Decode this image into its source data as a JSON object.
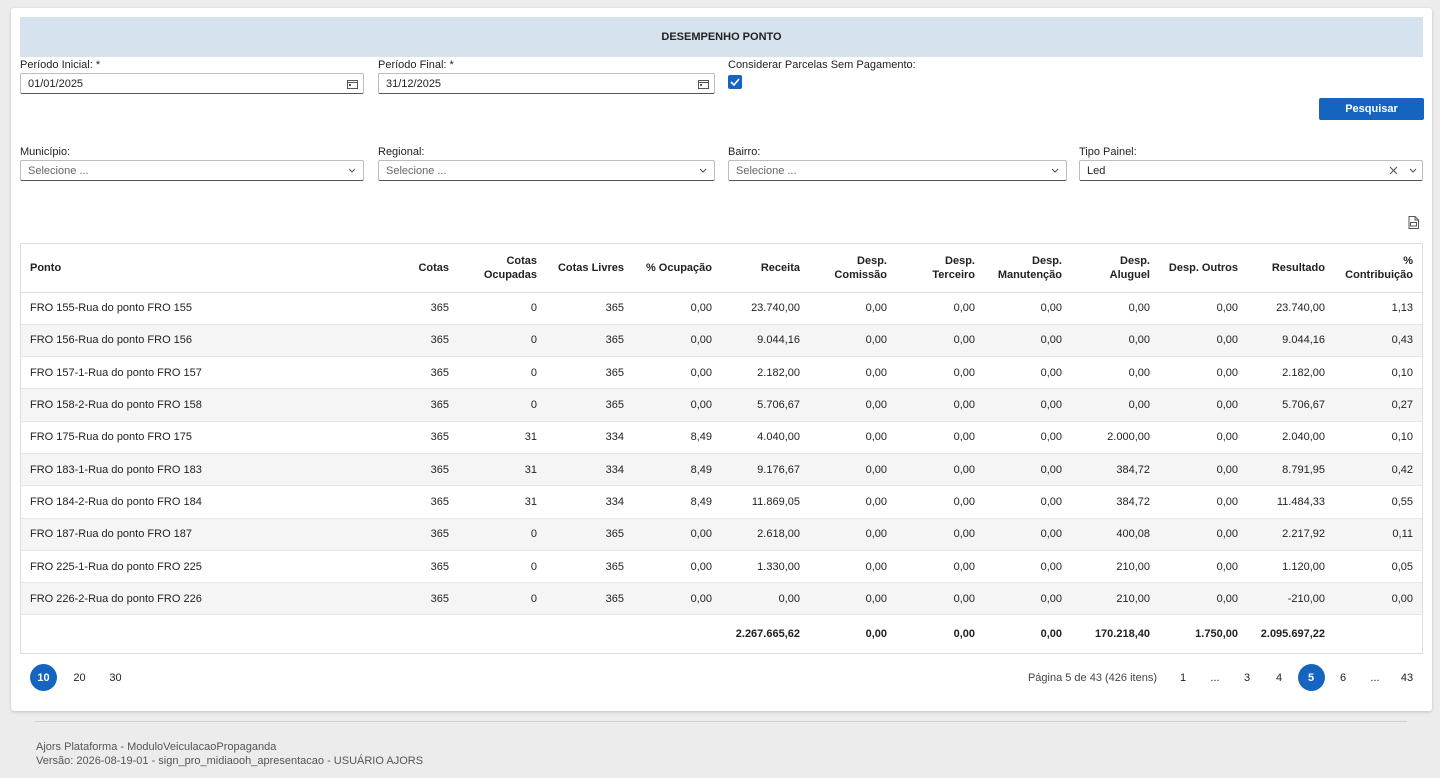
{
  "title": "DESEMPENHO PONTO",
  "filters": {
    "periodo_inicial": {
      "label": "Período Inicial: *",
      "value": "01/01/2025"
    },
    "periodo_final": {
      "label": "Período Final: *",
      "value": "31/12/2025"
    },
    "considerar": {
      "label": "Considerar Parcelas Sem Pagamento:",
      "checked": true
    },
    "search_label": "Pesquisar",
    "municipio": {
      "label": "Município:",
      "placeholder": "Selecione ..."
    },
    "regional": {
      "label": "Regional:",
      "placeholder": "Selecione ..."
    },
    "bairro": {
      "label": "Bairro:",
      "placeholder": "Selecione ..."
    },
    "tipo_painel": {
      "label": "Tipo Painel:",
      "value": "Led"
    }
  },
  "table": {
    "headers": [
      "Ponto",
      "Cotas",
      "Cotas Ocupadas",
      "Cotas Livres",
      "% Ocupação",
      "Receita",
      "Desp. Comissão",
      "Desp. Terceiro",
      "Desp. Manutenção",
      "Desp. Aluguel",
      "Desp. Outros",
      "Resultado",
      "% Contribuição"
    ],
    "rows": [
      [
        "FRO 155-Rua do ponto FRO 155",
        "365",
        "0",
        "365",
        "0,00",
        "23.740,00",
        "0,00",
        "0,00",
        "0,00",
        "0,00",
        "0,00",
        "23.740,00",
        "1,13"
      ],
      [
        "FRO 156-Rua do ponto FRO 156",
        "365",
        "0",
        "365",
        "0,00",
        "9.044,16",
        "0,00",
        "0,00",
        "0,00",
        "0,00",
        "0,00",
        "9.044,16",
        "0,43"
      ],
      [
        "FRO 157-1-Rua do ponto FRO 157",
        "365",
        "0",
        "365",
        "0,00",
        "2.182,00",
        "0,00",
        "0,00",
        "0,00",
        "0,00",
        "0,00",
        "2.182,00",
        "0,10"
      ],
      [
        "FRO 158-2-Rua do ponto FRO 158",
        "365",
        "0",
        "365",
        "0,00",
        "5.706,67",
        "0,00",
        "0,00",
        "0,00",
        "0,00",
        "0,00",
        "5.706,67",
        "0,27"
      ],
      [
        "FRO 175-Rua do ponto FRO 175",
        "365",
        "31",
        "334",
        "8,49",
        "4.040,00",
        "0,00",
        "0,00",
        "0,00",
        "2.000,00",
        "0,00",
        "2.040,00",
        "0,10"
      ],
      [
        "FRO 183-1-Rua do ponto FRO 183",
        "365",
        "31",
        "334",
        "8,49",
        "9.176,67",
        "0,00",
        "0,00",
        "0,00",
        "384,72",
        "0,00",
        "8.791,95",
        "0,42"
      ],
      [
        "FRO 184-2-Rua do ponto FRO 184",
        "365",
        "31",
        "334",
        "8,49",
        "11.869,05",
        "0,00",
        "0,00",
        "0,00",
        "384,72",
        "0,00",
        "11.484,33",
        "0,55"
      ],
      [
        "FRO 187-Rua do ponto FRO 187",
        "365",
        "0",
        "365",
        "0,00",
        "2.618,00",
        "0,00",
        "0,00",
        "0,00",
        "400,08",
        "0,00",
        "2.217,92",
        "0,11"
      ],
      [
        "FRO 225-1-Rua do ponto FRO 225",
        "365",
        "0",
        "365",
        "0,00",
        "1.330,00",
        "0,00",
        "0,00",
        "0,00",
        "210,00",
        "0,00",
        "1.120,00",
        "0,05"
      ],
      [
        "FRO 226-2-Rua do ponto FRO 226",
        "365",
        "0",
        "365",
        "0,00",
        "0,00",
        "0,00",
        "0,00",
        "0,00",
        "210,00",
        "0,00",
        "-210,00",
        "0,00"
      ]
    ],
    "totals": [
      "",
      "",
      "",
      "",
      "",
      "2.267.665,62",
      "0,00",
      "0,00",
      "0,00",
      "170.218,40",
      "1.750,00",
      "2.095.697,22",
      ""
    ]
  },
  "pager": {
    "sizes": [
      "10",
      "20",
      "30"
    ],
    "active_size": "10",
    "info": "Página 5 de 43 (426 itens)",
    "pages": [
      "1",
      "...",
      "3",
      "4",
      "5",
      "6",
      "...",
      "43"
    ],
    "active_page": "5"
  },
  "footer": {
    "line1": "Ajors Plataforma - ModuloVeiculacaoPropaganda",
    "line2": "Versão: 2026-08-19-01 - sign_pro_midiaooh_apresentacao - USUÁRIO AJORS"
  },
  "colors": {
    "accent": "#1565c0",
    "header_bg": "#d6e2ee"
  }
}
